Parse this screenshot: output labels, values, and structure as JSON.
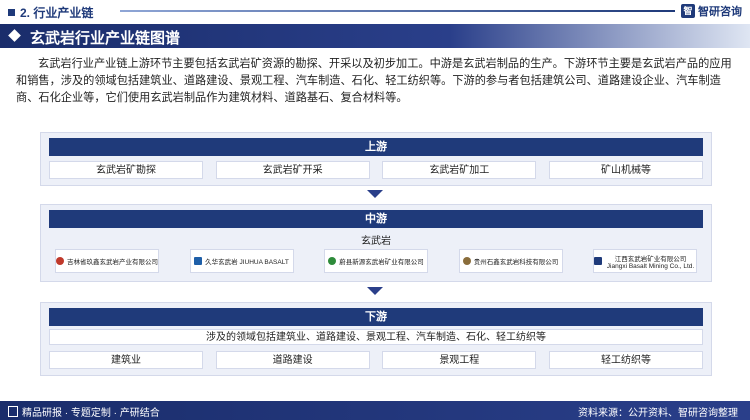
{
  "header": {
    "section": "2. 行业产业链",
    "brand": "智研咨询"
  },
  "title": "玄武岩行业产业链图谱",
  "intro": "玄武岩行业产业链上游环节主要包括玄武岩矿资源的勘探、开采以及初步加工。中游是玄武岩制品的生产。下游环节主要是玄武岩产品的应用和销售，涉及的领域包括建筑业、道路建设、景观工程、汽车制造、石化、轻工纺织等。下游的参与者包括建筑公司、道路建设企业、汽车制造商、石化企业等，它们使用玄武岩制品作为建筑材料、道路基石、复合材料等。",
  "upstream": {
    "head": "上游",
    "items": [
      "玄武岩矿勘探",
      "玄武岩矿开采",
      "玄武岩矿加工",
      "矿山机械等"
    ]
  },
  "midstream": {
    "head": "中游",
    "sub": "玄武岩",
    "companies": [
      {
        "name": "吉林省玖鑫玄武岩产业有限公司",
        "color": "#c0392b"
      },
      {
        "name": "久华玄武岩 JIUHUA BASALT",
        "color": "#1f5fa8"
      },
      {
        "name": "蔚县新源玄武岩矿业有限公司",
        "color": "#2e8b3a"
      },
      {
        "name": "贵州石鑫玄武岩科技有限公司",
        "color": "#8a6d3b"
      },
      {
        "name": "江西玄武岩矿业有限公司 Jiangxi Basalt Mining Co., Ltd.",
        "color": "#1f3a7a"
      }
    ]
  },
  "downstream": {
    "head": "下游",
    "sub": "涉及的领域包括建筑业、道路建设、景观工程、汽车制造、石化、轻工纺织等",
    "items": [
      "建筑业",
      "道路建设",
      "景观工程",
      "轻工纺织等"
    ]
  },
  "footer": {
    "left": "精品研报 · 专题定制 · 产研结合",
    "right": "资料来源：公开资料、智研咨询整理"
  }
}
